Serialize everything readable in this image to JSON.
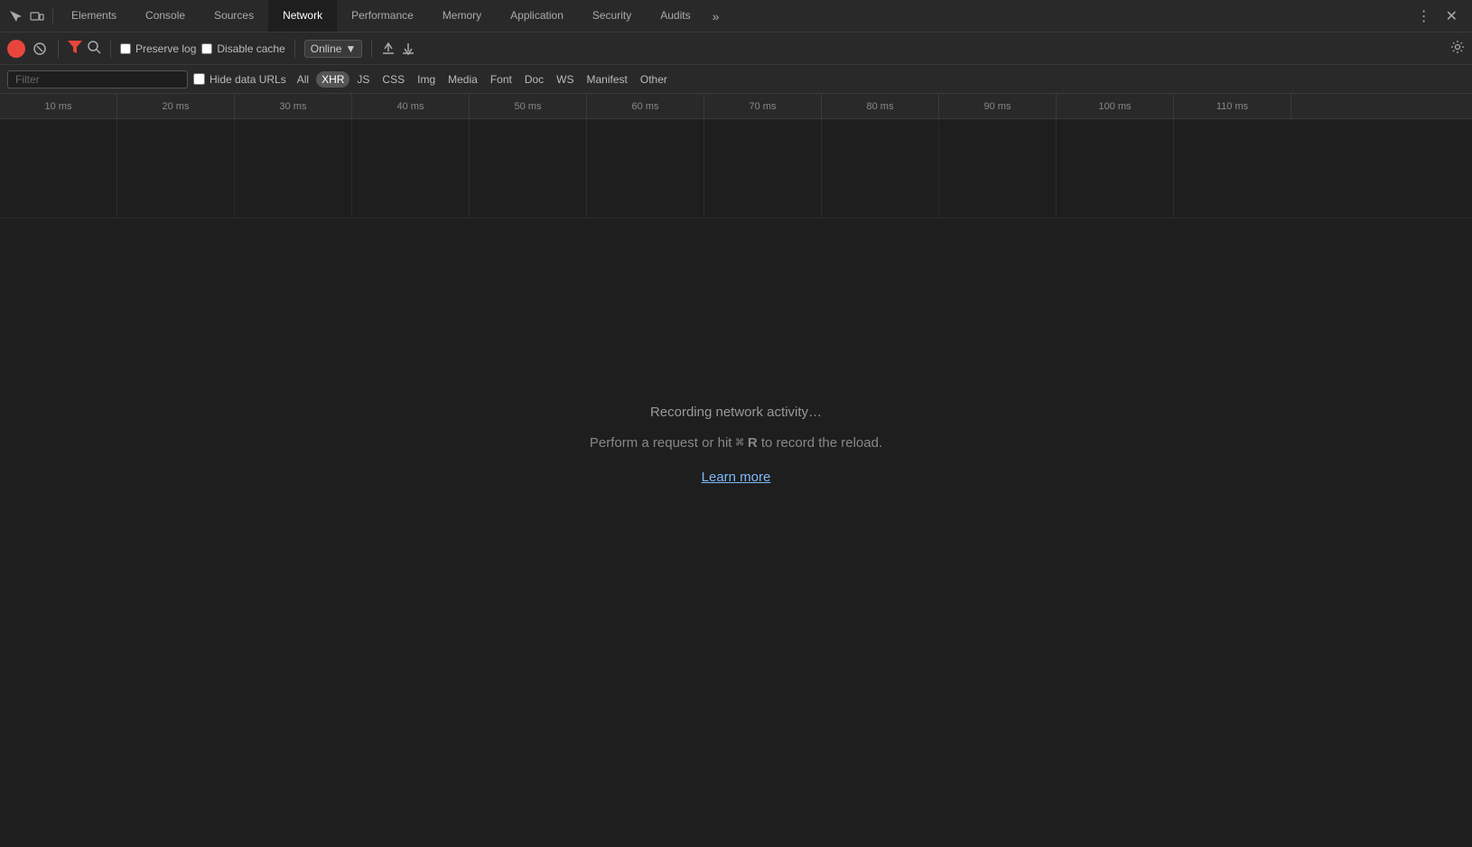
{
  "tabs": {
    "items": [
      {
        "id": "elements",
        "label": "Elements",
        "active": false
      },
      {
        "id": "console",
        "label": "Console",
        "active": false
      },
      {
        "id": "sources",
        "label": "Sources",
        "active": false
      },
      {
        "id": "network",
        "label": "Network",
        "active": true
      },
      {
        "id": "performance",
        "label": "Performance",
        "active": false
      },
      {
        "id": "memory",
        "label": "Memory",
        "active": false
      },
      {
        "id": "application",
        "label": "Application",
        "active": false
      },
      {
        "id": "security",
        "label": "Security",
        "active": false
      },
      {
        "id": "audits",
        "label": "Audits",
        "active": false
      }
    ],
    "overflow_label": "»",
    "more_label": "⋮",
    "close_label": "✕"
  },
  "toolbar": {
    "record_title": "Record",
    "clear_title": "Clear",
    "filter_title": "Filter",
    "search_title": "Search",
    "preserve_log_label": "Preserve log",
    "disable_cache_label": "Disable cache",
    "online_label": "Online",
    "online_arrow": "▼",
    "upload_title": "Import HAR file",
    "download_title": "Export HAR file",
    "settings_title": "Settings"
  },
  "filter_bar": {
    "placeholder": "Filter",
    "hide_data_urls_label": "Hide data URLs",
    "all_label": "All",
    "types": [
      {
        "id": "xhr",
        "label": "XHR",
        "active": true
      },
      {
        "id": "js",
        "label": "JS",
        "active": false
      },
      {
        "id": "css",
        "label": "CSS",
        "active": false
      },
      {
        "id": "img",
        "label": "Img",
        "active": false
      },
      {
        "id": "media",
        "label": "Media",
        "active": false
      },
      {
        "id": "font",
        "label": "Font",
        "active": false
      },
      {
        "id": "doc",
        "label": "Doc",
        "active": false
      },
      {
        "id": "ws",
        "label": "WS",
        "active": false
      },
      {
        "id": "manifest",
        "label": "Manifest",
        "active": false
      },
      {
        "id": "other",
        "label": "Other",
        "active": false
      }
    ]
  },
  "timeline": {
    "ticks": [
      "10 ms",
      "20 ms",
      "30 ms",
      "40 ms",
      "50 ms",
      "60 ms",
      "70 ms",
      "80 ms",
      "90 ms",
      "100 ms",
      "110 ms"
    ]
  },
  "main": {
    "recording_text": "Recording network activity…",
    "instruction_text": "Perform a request or hit",
    "cmd_symbol": "⌘",
    "r_key": "R",
    "instruction_suffix": "to record the reload.",
    "learn_more_label": "Learn more"
  }
}
